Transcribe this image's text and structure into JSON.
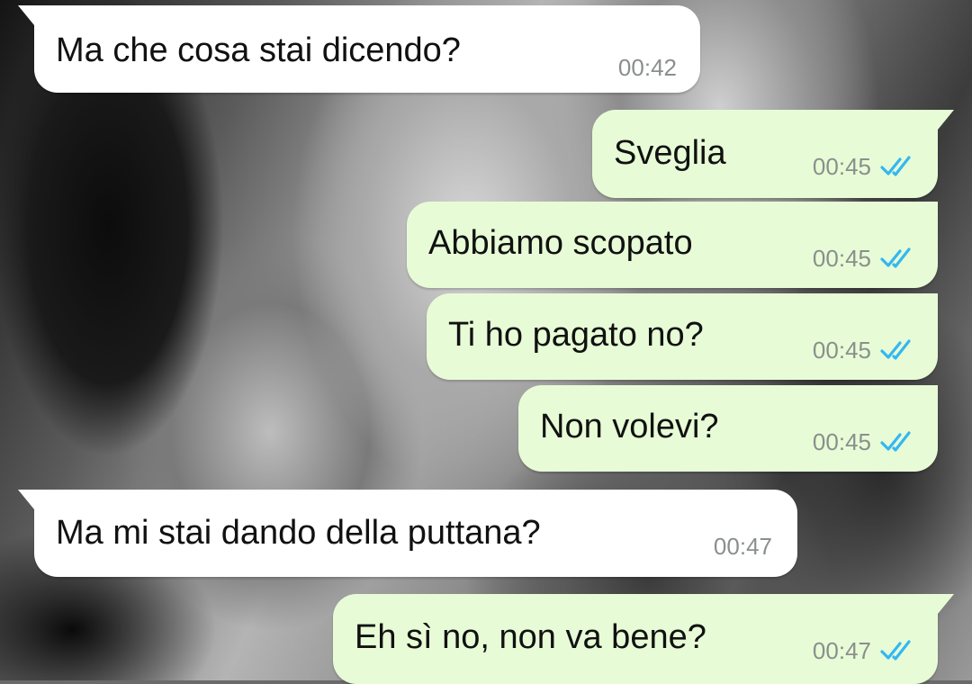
{
  "messages": [
    {
      "direction": "in",
      "text": "Ma che cosa stai dicendo?",
      "time": "00:42"
    },
    {
      "direction": "out",
      "text": "Sveglia",
      "time": "00:45",
      "status": "read"
    },
    {
      "direction": "out",
      "text": "Abbiamo scopato",
      "time": "00:45",
      "status": "read"
    },
    {
      "direction": "out",
      "text": "Ti ho pagato no?",
      "time": "00:45",
      "status": "read"
    },
    {
      "direction": "out",
      "text": "Non volevi?",
      "time": "00:45",
      "status": "read"
    },
    {
      "direction": "in",
      "text": "Ma mi stai dando della puttana?",
      "time": "00:47"
    },
    {
      "direction": "out",
      "text": "Eh sì no, non va bene?",
      "time": "00:47",
      "status": "read"
    }
  ],
  "colors": {
    "incoming_bubble": "#ffffff",
    "outgoing_bubble": "#e7fcd6",
    "read_ticks": "#34b7f1",
    "timestamp": "#8a8f8c"
  },
  "icons": {
    "read_status": "double-check-icon"
  }
}
